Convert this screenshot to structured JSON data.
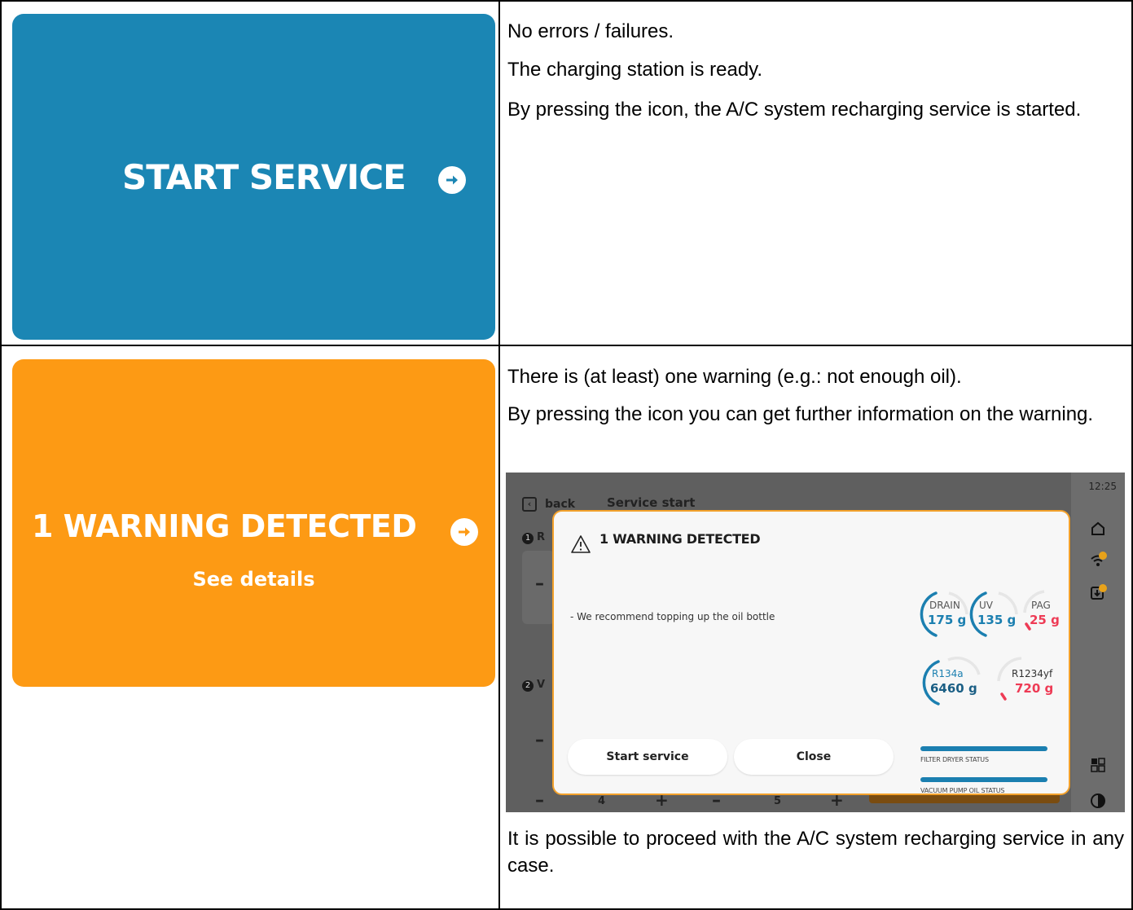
{
  "row1": {
    "tile": {
      "label": "START SERVICE",
      "color": "#1b86b4",
      "icon": "arrow-right-circle-icon"
    },
    "paragraphs": [
      "No errors / failures.",
      "The charging station is ready.",
      "By pressing the icon, the A/C system recharging service is started."
    ]
  },
  "row2": {
    "tile": {
      "label": "1 WARNING DETECTED",
      "sublabel": "See details",
      "color": "#fd9a14",
      "icon": "arrow-right-circle-icon"
    },
    "paragraphs": [
      "There is (at least) one warning (e.g.: not enough oil).",
      "By pressing the icon you can get further information on the warning."
    ],
    "footer": "It is possible to proceed with the A/C system recharging service in any case."
  },
  "screenshot": {
    "time": "12:25",
    "back": "back",
    "title": "Service start",
    "step1": "R",
    "step2": "V",
    "counter_a": "4",
    "counter_b": "5",
    "modal": {
      "title": "1 WARNING DETECTED",
      "message": "- We recommend topping up the oil bottle",
      "gauges": [
        {
          "name": "DRAIN",
          "value": "175 g",
          "status": "ok"
        },
        {
          "name": "UV",
          "value": "135 g",
          "status": "ok"
        },
        {
          "name": "PAG",
          "value": "25 g",
          "status": "low"
        },
        {
          "name": "R134a",
          "value": "6460 g",
          "status": "ok"
        },
        {
          "name": "R1234yf",
          "value": "720 g",
          "status": "low"
        }
      ],
      "status_bars": [
        {
          "label": "FILTER DRYER STATUS",
          "level": 1.0
        },
        {
          "label": "VACUUM PUMP OIL STATUS",
          "level": 1.0
        }
      ],
      "buttons": {
        "start": "Start service",
        "close": "Close"
      }
    }
  }
}
